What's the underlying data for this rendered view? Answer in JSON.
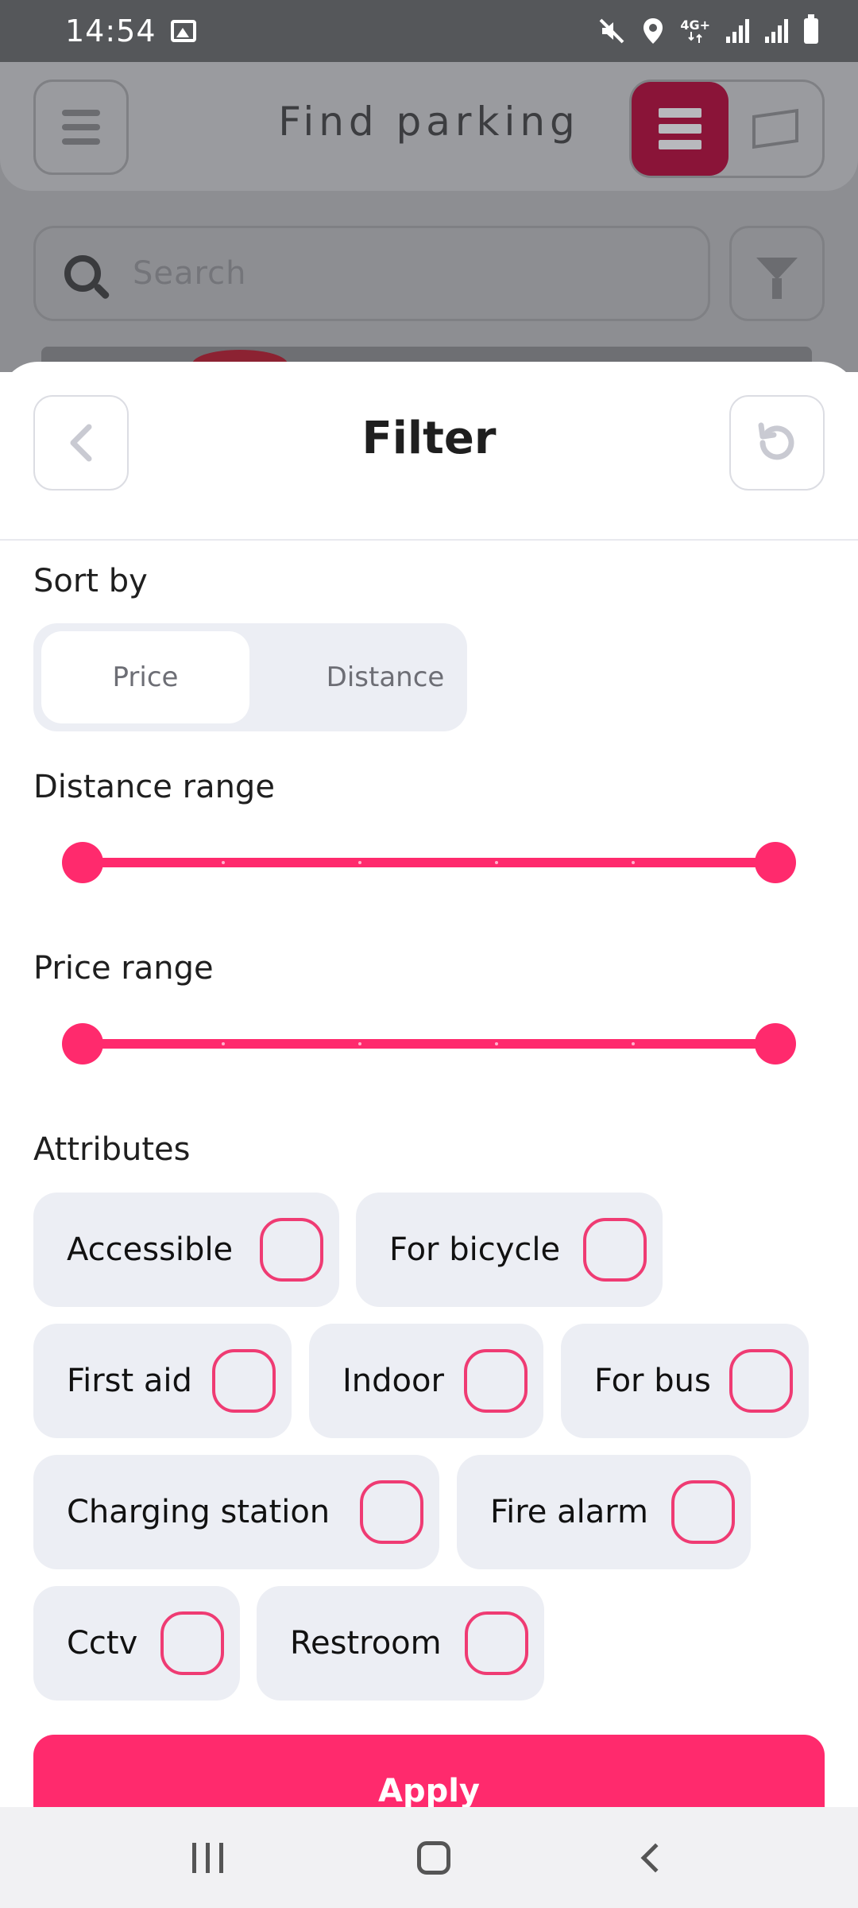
{
  "status_bar": {
    "time": "14:54",
    "icons": [
      "image-notification-icon",
      "mute-icon",
      "location-icon",
      "4g-icon",
      "signal-icon",
      "signal-icon",
      "battery-icon"
    ],
    "network_label": "4G+"
  },
  "background_app": {
    "title": "Find parking",
    "search_placeholder": "Search",
    "view_toggle": {
      "selected": "list",
      "options": [
        "list",
        "map"
      ]
    }
  },
  "filter_sheet": {
    "title": "Filter",
    "sort": {
      "label": "Sort by",
      "options": [
        "Price",
        "Distance"
      ],
      "selected": "Price"
    },
    "distance_range": {
      "label": "Distance range",
      "low_fraction": 0,
      "high_fraction": 1
    },
    "price_range": {
      "label": "Price range",
      "low_fraction": 0,
      "high_fraction": 1
    },
    "attributes": {
      "label": "Attributes",
      "items": [
        {
          "label": "Accessible",
          "checked": false
        },
        {
          "label": "For bicycle",
          "checked": false
        },
        {
          "label": "First aid",
          "checked": false
        },
        {
          "label": "Indoor",
          "checked": false
        },
        {
          "label": "For bus",
          "checked": false
        },
        {
          "label": "Charging station",
          "checked": false
        },
        {
          "label": "Fire alarm",
          "checked": false
        },
        {
          "label": "Cctv",
          "checked": false
        },
        {
          "label": "Restroom",
          "checked": false
        }
      ]
    },
    "apply_label": "Apply"
  },
  "colors": {
    "accent": "#ff2a6d",
    "chip_bg": "#eceef4",
    "checkbox_border": "#ef3b73",
    "toggle_active_dimmed": "#8a1438"
  }
}
